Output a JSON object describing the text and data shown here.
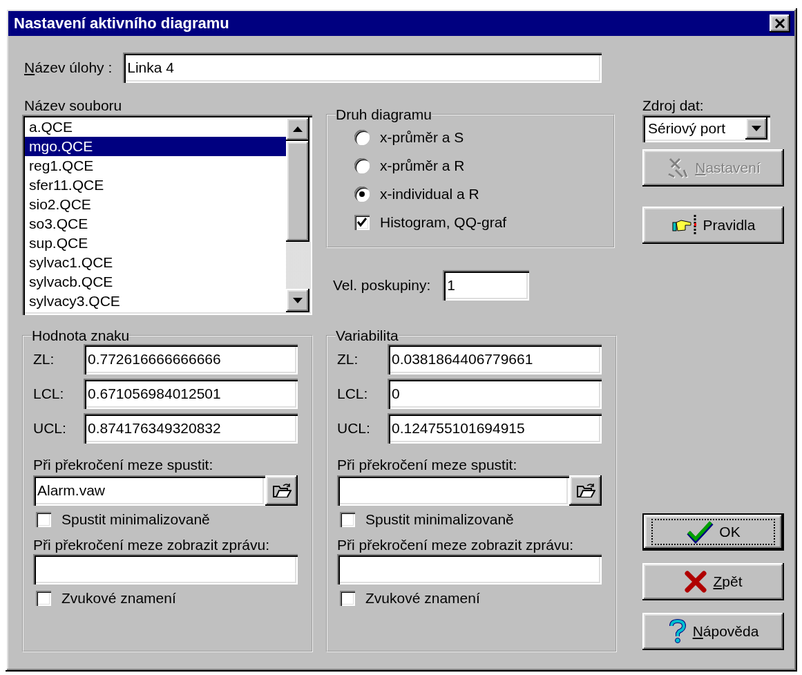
{
  "window": {
    "title": "Nastavení aktivního diagramu"
  },
  "task_name": {
    "label": "Název úlohy :",
    "underline_first": true,
    "value": "Linka 4"
  },
  "file_list": {
    "label": "Název souboru",
    "items": [
      {
        "label": "a.QCE",
        "selected": false
      },
      {
        "label": "mgo.QCE",
        "selected": true
      },
      {
        "label": "reg1.QCE",
        "selected": false
      },
      {
        "label": "sfer11.QCE",
        "selected": false
      },
      {
        "label": "sio2.QCE",
        "selected": false
      },
      {
        "label": "so3.QCE",
        "selected": false
      },
      {
        "label": "sup.QCE",
        "selected": false
      },
      {
        "label": "sylvac1.QCE",
        "selected": false
      },
      {
        "label": "sylvacb.QCE",
        "selected": false
      },
      {
        "label": "sylvacy3.QCE",
        "selected": false
      }
    ]
  },
  "diagram_type": {
    "title": "Druh diagramu",
    "options": [
      {
        "kind": "radio",
        "label": "x-průměr a S",
        "selected": false
      },
      {
        "kind": "radio",
        "label": "x-průměr a R",
        "selected": false
      },
      {
        "kind": "radio",
        "label": "x-individual a R",
        "selected": true
      },
      {
        "kind": "checkbox",
        "label": "Histogram, QQ-graf",
        "checked": true
      }
    ]
  },
  "subgroup_size": {
    "label": "Vel. poskupiny:",
    "value": "1"
  },
  "data_source": {
    "label": "Zdroj dat:",
    "value": "Sériový port"
  },
  "side_buttons": [
    {
      "kind": "settings",
      "label": "Nastavení",
      "underline_first": true,
      "disabled": true
    },
    {
      "kind": "rules",
      "label": "Pravidla",
      "underline_first": false,
      "disabled": false
    }
  ],
  "groups": [
    {
      "title": "Hodnota znaku",
      "limits": [
        {
          "label": "ZL:",
          "value": "0.772616666666666"
        },
        {
          "label": "LCL:",
          "value": "0.671056984012501"
        },
        {
          "label": "UCL:",
          "value": "0.874176349320832"
        }
      ],
      "run_label": "Při překročení meze spustit:",
      "run_value": "Alarm.vaw",
      "minimized": {
        "label": "Spustit minimalizovaně",
        "checked": false
      },
      "message_label": "Při překročení meze zobrazit zprávu:",
      "sound": {
        "label": "Zvukové znamení",
        "checked": false
      }
    },
    {
      "title": "Variabilita",
      "limits": [
        {
          "label": "ZL:",
          "value": "0.0381864406779661"
        },
        {
          "label": "LCL:",
          "value": "0"
        },
        {
          "label": "UCL:",
          "value": "0.124755101694915"
        }
      ],
      "run_label": "Při překročení meze spustit:",
      "minimized": {
        "label": "Spustit minimalizovaně",
        "checked": false
      },
      "message_label": "Při překročení meze zobrazit zprávu:",
      "sound": {
        "label": "Zvukové znamení",
        "checked": false
      }
    }
  ],
  "dialog_buttons": [
    {
      "kind": "ok",
      "label": "OK",
      "underline_first": false,
      "default": true
    },
    {
      "kind": "cancel",
      "label": "Zpět",
      "underline_first": true,
      "default": false
    },
    {
      "kind": "help",
      "label": "Nápověda",
      "underline_first": true,
      "default": false
    }
  ]
}
